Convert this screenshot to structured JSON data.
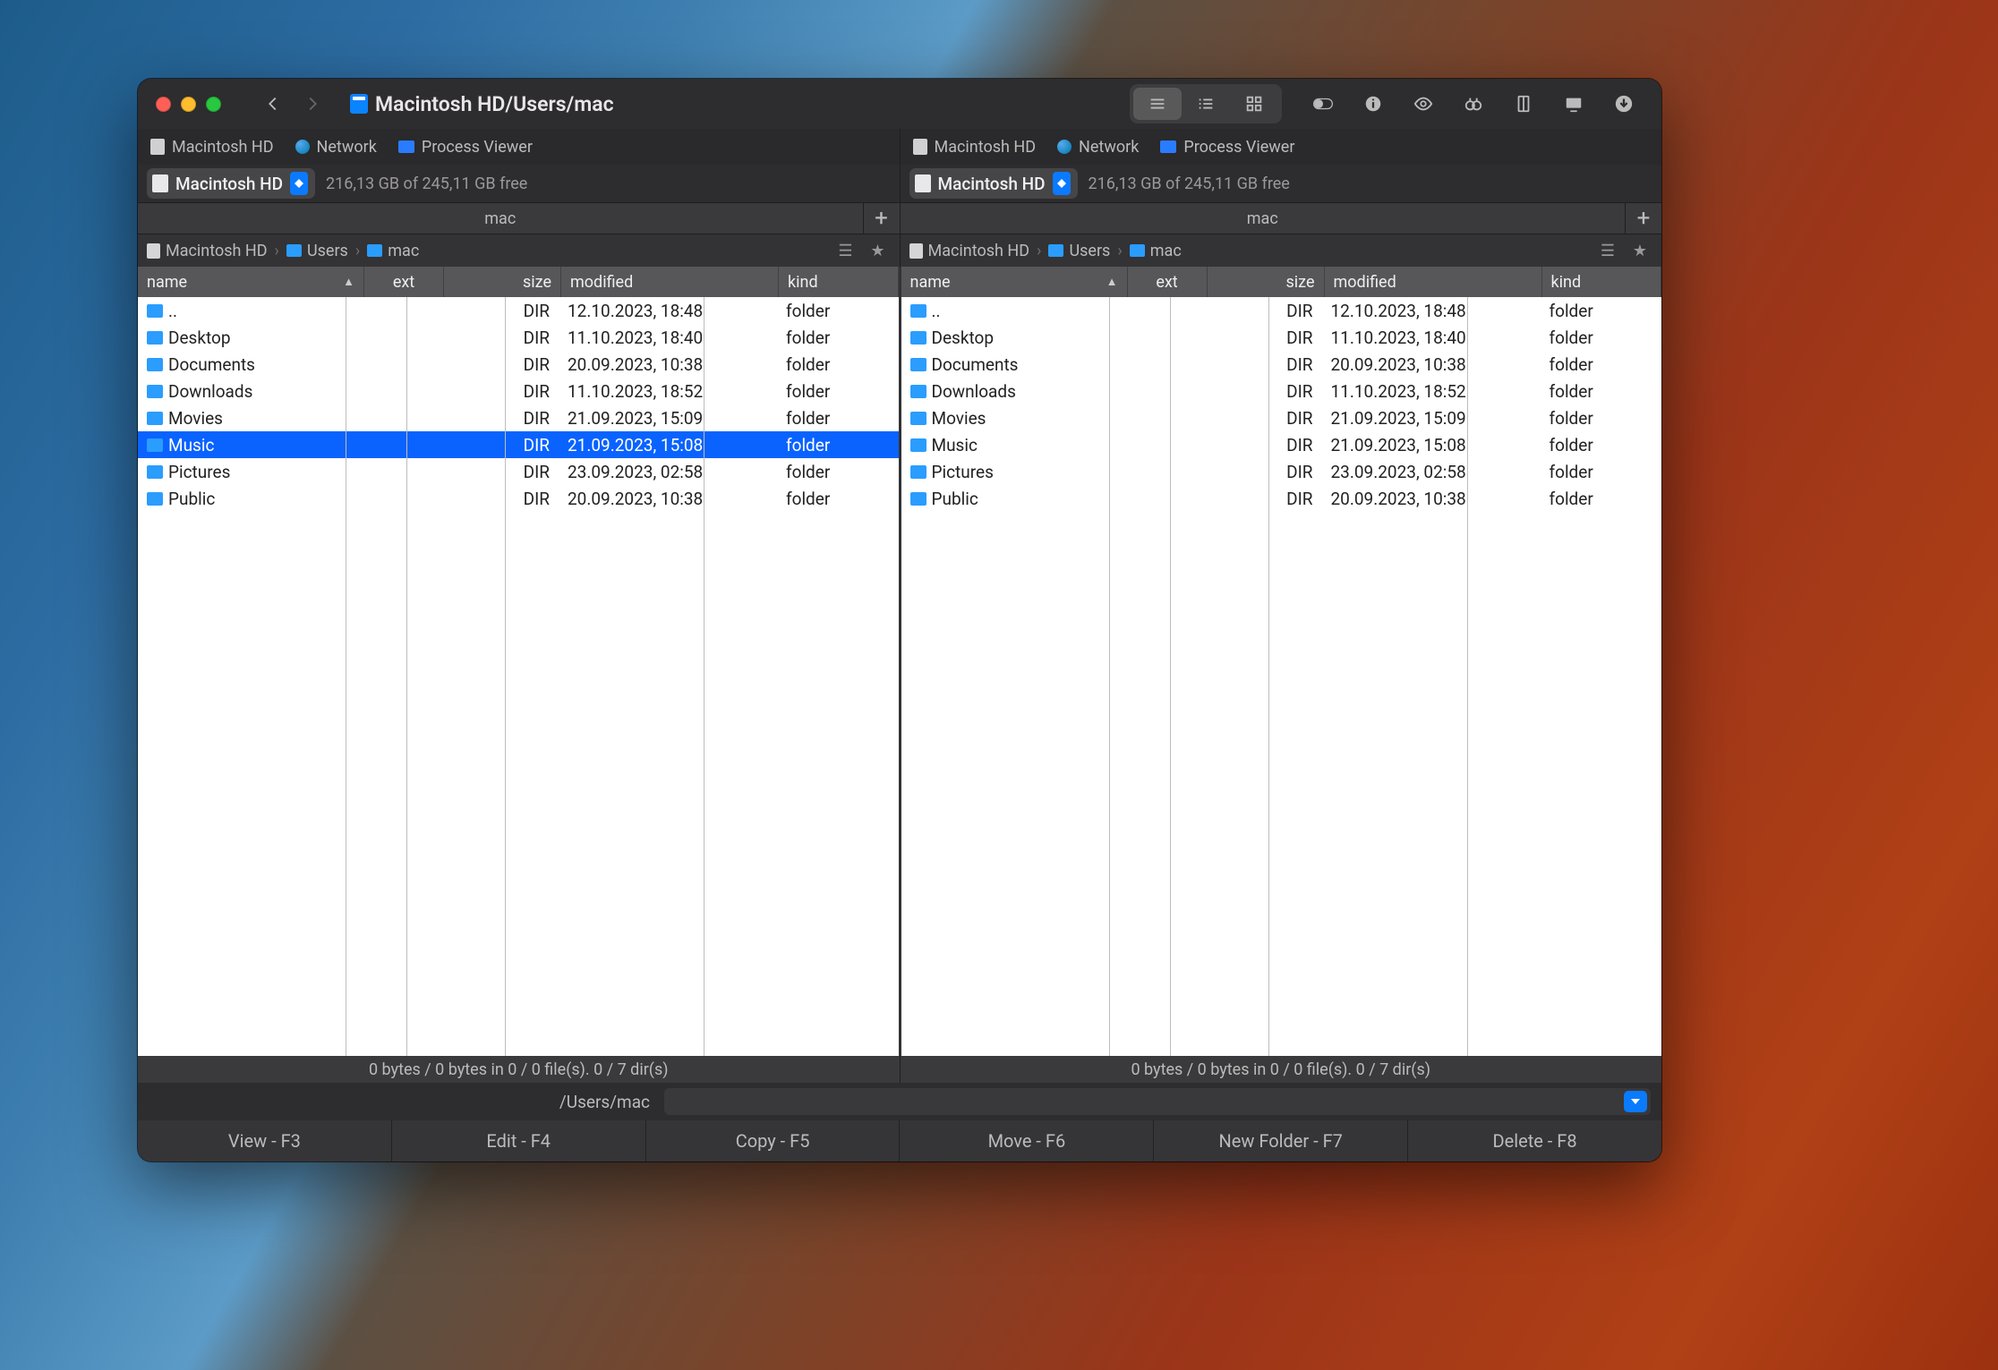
{
  "titlebar": {
    "path_text": "Macintosh HD/Users/mac"
  },
  "loc_tabs": {
    "hd": "Macintosh HD",
    "net": "Network",
    "proc": "Process Viewer"
  },
  "volume": {
    "name": "Macintosh HD",
    "free_text": "216,13 GB of 245,11 GB free"
  },
  "tab": {
    "name": "mac"
  },
  "breadcrumb": {
    "seg1": "Macintosh HD",
    "seg2": "Users",
    "seg3": "mac"
  },
  "columns": {
    "name": "name",
    "ext": "ext",
    "size": "size",
    "modified": "modified",
    "kind": "kind"
  },
  "files": [
    {
      "name": "..",
      "ext": "",
      "size": "DIR",
      "modified": "12.10.2023, 18:48",
      "kind": "folder",
      "selected": false
    },
    {
      "name": "Desktop",
      "ext": "",
      "size": "DIR",
      "modified": "11.10.2023, 18:40",
      "kind": "folder",
      "selected": false
    },
    {
      "name": "Documents",
      "ext": "",
      "size": "DIR",
      "modified": "20.09.2023, 10:38",
      "kind": "folder",
      "selected": false
    },
    {
      "name": "Downloads",
      "ext": "",
      "size": "DIR",
      "modified": "11.10.2023, 18:52",
      "kind": "folder",
      "selected": false
    },
    {
      "name": "Movies",
      "ext": "",
      "size": "DIR",
      "modified": "21.09.2023, 15:09",
      "kind": "folder",
      "selected": false
    },
    {
      "name": "Music",
      "ext": "",
      "size": "DIR",
      "modified": "21.09.2023, 15:08",
      "kind": "folder",
      "selected": true
    },
    {
      "name": "Pictures",
      "ext": "",
      "size": "DIR",
      "modified": "23.09.2023, 02:58",
      "kind": "folder",
      "selected": false
    },
    {
      "name": "Public",
      "ext": "",
      "size": "DIR",
      "modified": "20.09.2023, 10:38",
      "kind": "folder",
      "selected": false
    }
  ],
  "files_right": [
    {
      "name": "..",
      "ext": "",
      "size": "DIR",
      "modified": "12.10.2023, 18:48",
      "kind": "folder",
      "selected": false
    },
    {
      "name": "Desktop",
      "ext": "",
      "size": "DIR",
      "modified": "11.10.2023, 18:40",
      "kind": "folder",
      "selected": false
    },
    {
      "name": "Documents",
      "ext": "",
      "size": "DIR",
      "modified": "20.09.2023, 10:38",
      "kind": "folder",
      "selected": false
    },
    {
      "name": "Downloads",
      "ext": "",
      "size": "DIR",
      "modified": "11.10.2023, 18:52",
      "kind": "folder",
      "selected": false
    },
    {
      "name": "Movies",
      "ext": "",
      "size": "DIR",
      "modified": "21.09.2023, 15:09",
      "kind": "folder",
      "selected": false
    },
    {
      "name": "Music",
      "ext": "",
      "size": "DIR",
      "modified": "21.09.2023, 15:08",
      "kind": "folder",
      "selected": false
    },
    {
      "name": "Pictures",
      "ext": "",
      "size": "DIR",
      "modified": "23.09.2023, 02:58",
      "kind": "folder",
      "selected": false
    },
    {
      "name": "Public",
      "ext": "",
      "size": "DIR",
      "modified": "20.09.2023, 10:38",
      "kind": "folder",
      "selected": false
    }
  ],
  "status_text": "0 bytes / 0 bytes in 0 / 0 file(s). 0 / 7 dir(s)",
  "path_input": {
    "label": "/Users/mac"
  },
  "fnkeys": {
    "f3": "View - F3",
    "f4": "Edit - F4",
    "f5": "Copy - F5",
    "f6": "Move - F6",
    "f7": "New Folder - F7",
    "f8": "Delete - F8"
  }
}
